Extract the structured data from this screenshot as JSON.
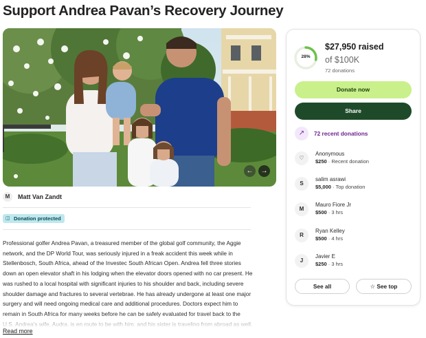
{
  "page": {
    "title": "Support Andrea Pavan’s Recovery Journey"
  },
  "organizer": {
    "initial": "M",
    "name": "Matt Van Zandt"
  },
  "badge": {
    "label": "Donation protected"
  },
  "story": {
    "text": "Professional golfer Andrea Pavan, a treasured member of the global golf community, the Aggie network, and the DP World Tour, was seriously injured in a freak accident this week while in Stellenbosch, South Africa, ahead of the Investec South African Open. Andrea fell three stories down an open elevator shaft in his lodging when the elevator doors opened with no car present. He was rushed to a local hospital with significant injuries to his shoulder and back, including severe shoulder damage and fractures to several vertebrae. He has already undergone at least one major surgery and will need ongoing medical care and additional procedures. Doctors expect him to remain in South Africa for many weeks before he can be safely evaluated for travel back to the U.S. Andrea’s wife, Audra, is en route to be with him, and his sister is traveling from abroad as well. Several fellow players",
    "read_more": "Read more"
  },
  "fundraiser": {
    "progress_percent": 28,
    "progress_label": "28%",
    "raised": "$27,950 raised",
    "goal": "of $100K",
    "donation_count": "72 donations",
    "donate_label": "Donate now",
    "share_label": "Share",
    "recent_label": "72 recent donations",
    "accent": "#c9f08a",
    "share_color": "#1f4a2a",
    "ring_color": "#6cc24a"
  },
  "donors": [
    {
      "initial": "",
      "icon": "heart-hand-icon",
      "name": "Anonymous",
      "amount": "$250",
      "detail": " · Recent donation"
    },
    {
      "initial": "S",
      "name": "salim asrawi",
      "amount": "$5,000",
      "detail": " · Top donation"
    },
    {
      "initial": "M",
      "name": "Mauro Fiore Jr",
      "amount": "$500",
      "detail": " · 3 hrs"
    },
    {
      "initial": "R",
      "name": "Ryan Kelley",
      "amount": "$500",
      "detail": " · 4 hrs"
    },
    {
      "initial": "J",
      "name": "Javier E",
      "amount": "$250",
      "detail": " · 3 hrs"
    }
  ],
  "actions": {
    "see_all": "See all",
    "see_top": "See top"
  }
}
